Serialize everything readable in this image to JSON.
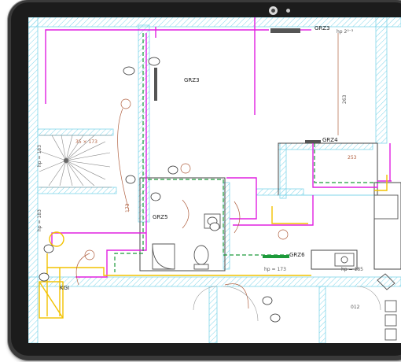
{
  "labels": {
    "grz3_top": "GRZ3",
    "grz3_room": "GRZ3",
    "grz4": "GRZ4",
    "grz5": "GRZ5",
    "grz6": "GRZ6",
    "kgi": "KGI",
    "hp_top": "hp  2⁰⁻³",
    "hp_stair": "hp = 183",
    "hp_stair2": "hp = 183",
    "hp_bottom": "hp = 173",
    "hp_kitchen": "hp = 185",
    "dim_263": "263",
    "dim_253": "253",
    "dim_173": "173",
    "dim_small": "35 × 173",
    "num_012": "012"
  },
  "colors": {
    "wall": "#7fd6ea",
    "heating": "#e020e0",
    "water": "#f2c200",
    "dim": "#b06040",
    "fixture": "#555555",
    "green": "#1c9a3a"
  }
}
